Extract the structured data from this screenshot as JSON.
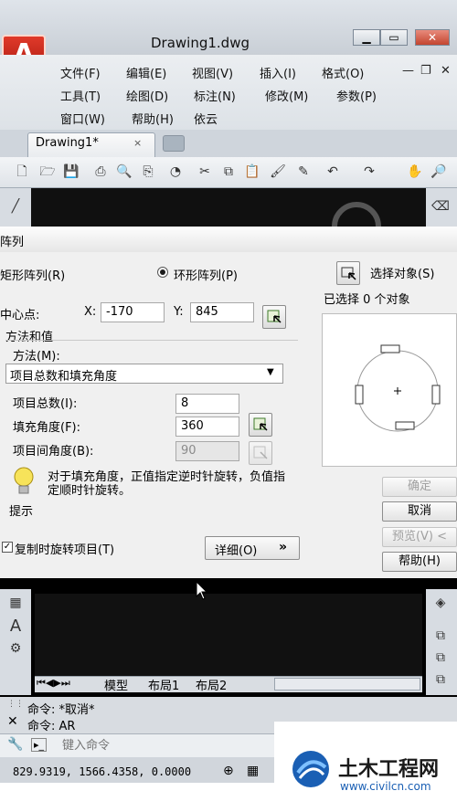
{
  "window": {
    "title": "Drawing1.dwg",
    "logo": "A"
  },
  "menubar": {
    "row1": [
      "文件(F)",
      "编辑(E)",
      "视图(V)",
      "插入(I)",
      "格式(O)"
    ],
    "row2": [
      "工具(T)",
      "绘图(D)",
      "标注(N)",
      "修改(M)",
      "参数(P)"
    ],
    "row3": [
      "窗口(W)",
      "帮助(H)",
      "依云"
    ]
  },
  "tabs": {
    "active": "Drawing1*",
    "close": "×"
  },
  "icons": [
    "new-icon",
    "open-icon",
    "save-icon",
    "print-icon",
    "print-preview-icon",
    "publish-icon",
    "3d-dwf-icon",
    "cut-icon",
    "copy-icon",
    "paste-icon",
    "match-properties-icon",
    "undo-icon",
    "redo-icon",
    "pan-icon",
    "zoom-icon"
  ],
  "dialog": {
    "title": "阵列",
    "rect_label": "矩形阵列(R)",
    "polar_label": "环形阵列(P)",
    "select_objects": "选择对象(S)",
    "selected_count_text": "已选择 0 个对象",
    "center_label": "中心点:",
    "x_label": "X:",
    "x_value": "-170",
    "y_label": "Y:",
    "y_value": "845",
    "group_label": "方法和值",
    "method_label": "方法(M):",
    "method_value": "项目总数和填充角度",
    "total_label": "项目总数(I):",
    "total_value": "8",
    "fill_label": "填充角度(F):",
    "fill_value": "360",
    "between_label": "项目间角度(B):",
    "between_value": "90",
    "tip_text": "对于填充角度，正值指定逆时针旋转，负值指定顺时针旋转。",
    "tip_label": "提示",
    "rotate_label": "复制时旋转项目(T)",
    "rotate_checked": "✓",
    "details_label": "详细(O)",
    "ok_label": "确定",
    "cancel_label": "取消",
    "preview_label": "预览(V) <",
    "help_label": "帮助(H)"
  },
  "layout_tabs": [
    "模型",
    "布局1",
    "布局2"
  ],
  "command": {
    "history1": "命令:  *取消*",
    "history2": "命令:  AR",
    "placeholder": "键入命令"
  },
  "status": {
    "coords": "829.9319, 1566.4358, 0.0000"
  },
  "watermark": {
    "brand": "土木工程网",
    "url": "www.civilcn.com"
  },
  "colors": {
    "accent_red": "#c8281a",
    "canvas": "#000000",
    "dialog_bg": "#f0f0f0"
  }
}
